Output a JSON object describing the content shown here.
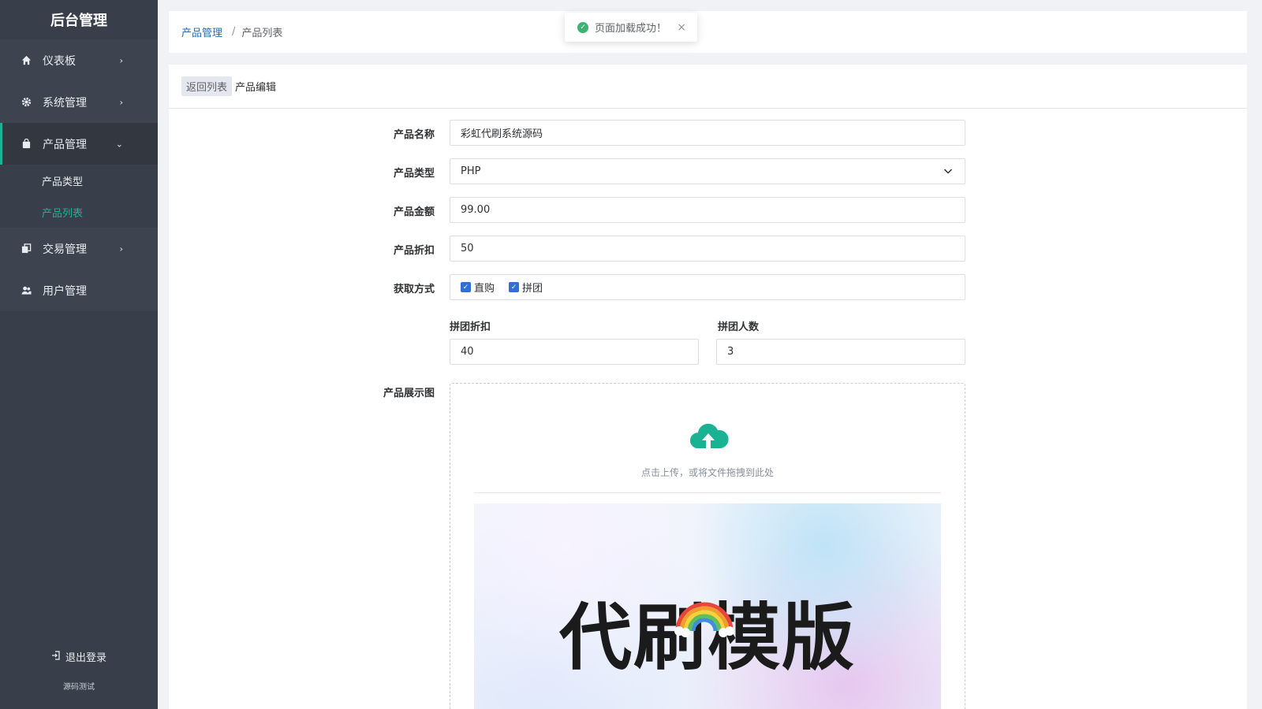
{
  "brand": "后台管理",
  "sidebar": {
    "items": [
      {
        "label": "仪表板",
        "icon": "home-icon",
        "arrow": "›"
      },
      {
        "label": "系统管理",
        "icon": "gear-icon",
        "arrow": "›"
      },
      {
        "label": "产品管理",
        "icon": "bag-icon",
        "arrow": "⌄"
      },
      {
        "label": "交易管理",
        "icon": "copy-icon",
        "arrow": "›"
      },
      {
        "label": "用户管理",
        "icon": "users-icon"
      }
    ],
    "sub_items": [
      {
        "label": "产品类型"
      },
      {
        "label": "产品列表"
      }
    ],
    "logout": "退出登录",
    "footer": "源码测试"
  },
  "breadcrumb": {
    "parent": "产品管理",
    "separator": "/",
    "current": "产品列表"
  },
  "toast": {
    "message": "页面加载成功！",
    "close": "×"
  },
  "card": {
    "back": "返回列表",
    "title": "产品编辑"
  },
  "form": {
    "name_label": "产品名称",
    "name_value": "彩虹代刷系统源码",
    "type_label": "产品类型",
    "type_value": "PHP",
    "price_label": "产品金额",
    "price_value": "99.00",
    "discount_label": "产品折扣",
    "discount_value": "50",
    "method_label": "获取方式",
    "method_options": [
      {
        "label": "直购",
        "checked": true
      },
      {
        "label": "拼团",
        "checked": true
      }
    ],
    "group_discount_label": "拼团折扣",
    "group_discount_value": "40",
    "group_size_label": "拼团人数",
    "group_size_value": "3",
    "image_label": "产品展示图",
    "upload_hint": "点击上传，或将文件拖拽到此处",
    "preview_text": "代刷模版"
  },
  "colors": {
    "accent": "#19b394",
    "sidebar": "#393f4a",
    "link": "#2a6fb3",
    "checkbox": "#2f6fd6"
  }
}
